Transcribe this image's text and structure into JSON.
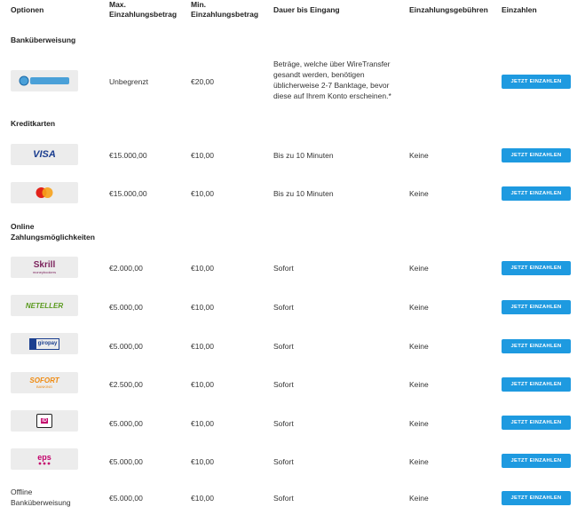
{
  "headers": {
    "optionen": "Optionen",
    "max": "Max. Einzahlungsbetrag",
    "min": "Min. Einzahlungsbetrag",
    "dauer": "Dauer bis Eingang",
    "gebuehren": "Einzahlungsgebühren",
    "einzahlen": "Einzahlen"
  },
  "sections": {
    "bank": "Banküberweisung",
    "kredit": "Kreditkarten",
    "online": "Online Zahlungsmöglichkeiten"
  },
  "button_label": "JETZT EINZAHLEN",
  "colors": {
    "button": "#1e9ae0"
  },
  "rows": [
    {
      "logo": "wiretransfer-logo",
      "max": "Unbegrenzt",
      "min": "€20,00",
      "dauer": "Beträge, welche über WireTransfer gesandt werden, benötigen üblicherweise 2-7 Banktage, bevor diese auf Ihrem Konto erscheinen.*",
      "gebuehren": ""
    },
    {
      "logo": "visa-logo",
      "logo_text": "VISA",
      "max": "€15.000,00",
      "min": "€10,00",
      "dauer": "Bis zu 10 Minuten",
      "gebuehren": "Keine"
    },
    {
      "logo": "mastercard-logo",
      "max": "€15.000,00",
      "min": "€10,00",
      "dauer": "Bis zu 10 Minuten",
      "gebuehren": "Keine"
    },
    {
      "logo": "skrill-logo",
      "logo_text": "Skrill",
      "logo_sub": "moneybookers",
      "max": "€2.000,00",
      "min": "€10,00",
      "dauer": "Sofort",
      "gebuehren": "Keine"
    },
    {
      "logo": "neteller-logo",
      "logo_text": "NETELLER",
      "max": "€5.000,00",
      "min": "€10,00",
      "dauer": "Sofort",
      "gebuehren": "Keine"
    },
    {
      "logo": "giropay-logo",
      "logo_text": "giropay",
      "max": "€5.000,00",
      "min": "€10,00",
      "dauer": "Sofort",
      "gebuehren": "Keine"
    },
    {
      "logo": "sofort-logo",
      "logo_text": "SOFORT",
      "logo_sub": "BANKING",
      "max": "€2.500,00",
      "min": "€10,00",
      "dauer": "Sofort",
      "gebuehren": "Keine"
    },
    {
      "logo": "ideal-logo",
      "logo_text": "iD",
      "max": "€5.000,00",
      "min": "€10,00",
      "dauer": "Sofort",
      "gebuehren": "Keine"
    },
    {
      "logo": "eps-logo",
      "logo_text": "eps",
      "max": "€5.000,00",
      "min": "€10,00",
      "dauer": "Sofort",
      "gebuehren": "Keine"
    },
    {
      "label": "Offline Banküberweisung",
      "max": "€5.000,00",
      "min": "€10,00",
      "dauer": "Sofort",
      "gebuehren": "Keine"
    }
  ]
}
